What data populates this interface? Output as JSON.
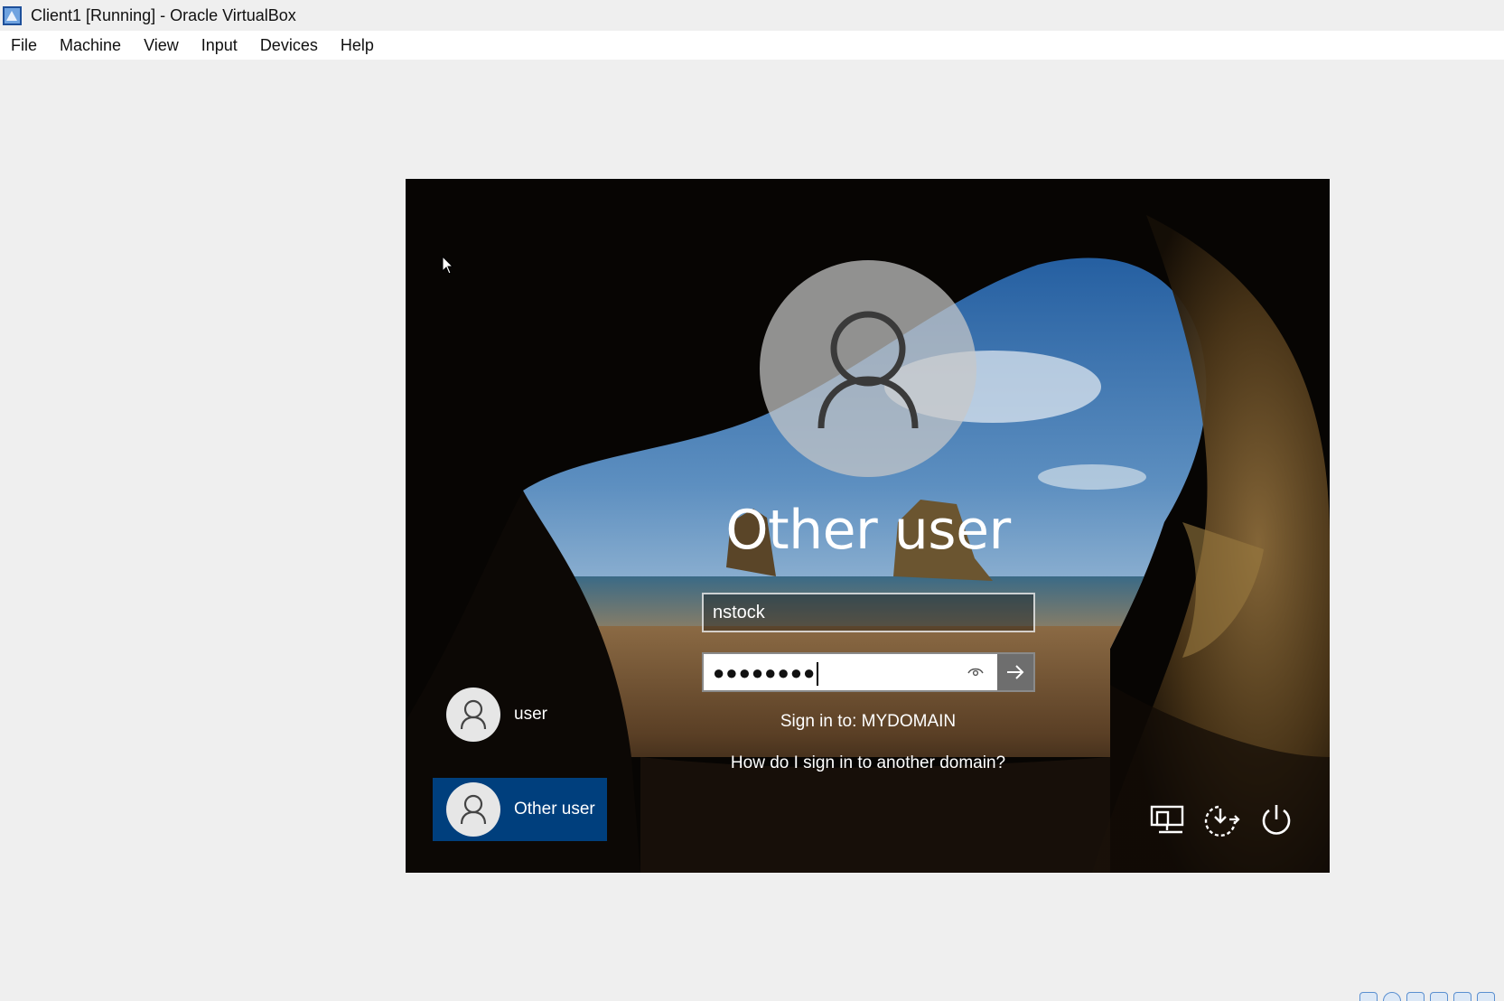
{
  "window": {
    "title": "Client1 [Running] - Oracle VirtualBox",
    "icon": "virtualbox-app-icon"
  },
  "menubar": {
    "items": [
      {
        "label": "File"
      },
      {
        "label": "Machine"
      },
      {
        "label": "View"
      },
      {
        "label": "Input"
      },
      {
        "label": "Devices"
      },
      {
        "label": "Help"
      }
    ]
  },
  "login": {
    "display_name": "Other user",
    "username_value": "nstock",
    "password_mask": "●●●●●●●●",
    "sign_in_to": "Sign in to: MYDOMAIN",
    "other_domain_link": "How do I sign in to another domain?",
    "reveal_icon": "eye-icon",
    "submit_icon": "arrow-right-icon"
  },
  "user_tiles": [
    {
      "label": "user",
      "selected": false
    },
    {
      "label": "Other user",
      "selected": true
    }
  ],
  "corner_buttons": [
    {
      "icon": "network-icon"
    },
    {
      "icon": "ease-of-access-icon"
    },
    {
      "icon": "power-icon"
    }
  ],
  "colors": {
    "selected_tile": "#003f7d",
    "submit_button": "#6e6e6e",
    "host_background": "#efefef"
  }
}
